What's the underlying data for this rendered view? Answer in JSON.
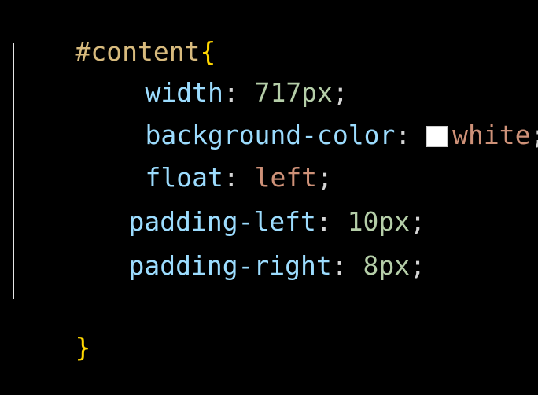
{
  "code": {
    "selector": "#content",
    "open_brace": "{",
    "close_brace": "}",
    "lines": [
      {
        "property": "width",
        "value": "717px"
      },
      {
        "property": "background-color",
        "value": "white",
        "swatch_color": "#ffffff"
      },
      {
        "property": "float",
        "value": "left"
      },
      {
        "property": "padding-left",
        "value": "10px"
      },
      {
        "property": "padding-right",
        "value": "8px"
      }
    ],
    "colon": ": ",
    "semicolon": ";"
  },
  "colors": {
    "background": "#000000",
    "selector": "#d7ba7d",
    "brace": "#ffd700",
    "property": "#9cdcfe",
    "number": "#b5cea8",
    "keyword": "#ce9178"
  }
}
